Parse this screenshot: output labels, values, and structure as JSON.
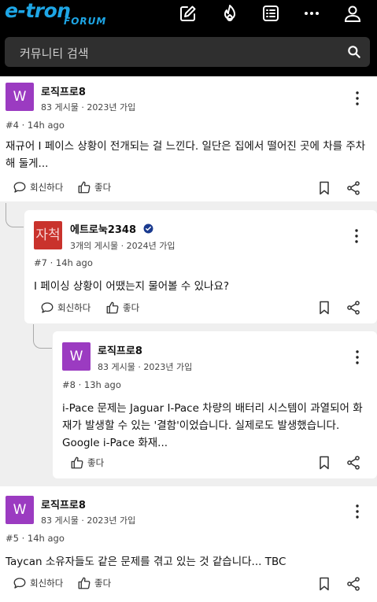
{
  "header": {
    "logo_main": "e-tron",
    "logo_sub": "FORUM",
    "icons": [
      "edit-icon",
      "flame-icon",
      "list-icon",
      "more-icon",
      "user-icon"
    ]
  },
  "search": {
    "placeholder": "커뮤니티 검색"
  },
  "labels": {
    "reply": "회신하다",
    "like": "좋다"
  },
  "posts": [
    {
      "avatar": "W",
      "username": "로직프로8",
      "meta": "83 게시물 · 2023년 가입",
      "post_meta": "#4 · 14h ago",
      "text": "재규어 I 페이스 상황이 전개되는 걸 느낀다. 일단은 집에서 떨어진 곳에 차를 주차해 둘게..."
    },
    {
      "avatar": "자척",
      "username": "에트로눅2348",
      "verified": true,
      "meta": "3개의 게시물 · 2024년 가입",
      "post_meta": "#7 · 14h ago",
      "text": "I 페이싱 상황이 어땠는지 물어볼 수 있나요?"
    },
    {
      "avatar": "W",
      "username": "로직프로8",
      "meta": "83 게시물 · 2023년 가입",
      "post_meta": "#8 · 13h ago",
      "text": "i-Pace 문제는 Jaguar I-Pace 차량의 배터리 시스템이 과열되어 화재가 발생할 수 있는 '결함'이었습니다. 실제로도 발생했습니다. Google i-Pace 화재..."
    },
    {
      "avatar": "W",
      "username": "로직프로8",
      "meta": "83 게시물 · 2023년 가입",
      "post_meta": "#5 · 14h ago",
      "text": "Taycan 소유자들도 같은 문제를 겪고 있는 것 같습니다... TBC"
    }
  ],
  "colors": {
    "accent": "#1ea6e6",
    "avatar_purple": "#9b3bc1",
    "avatar_red": "#c9322c"
  }
}
